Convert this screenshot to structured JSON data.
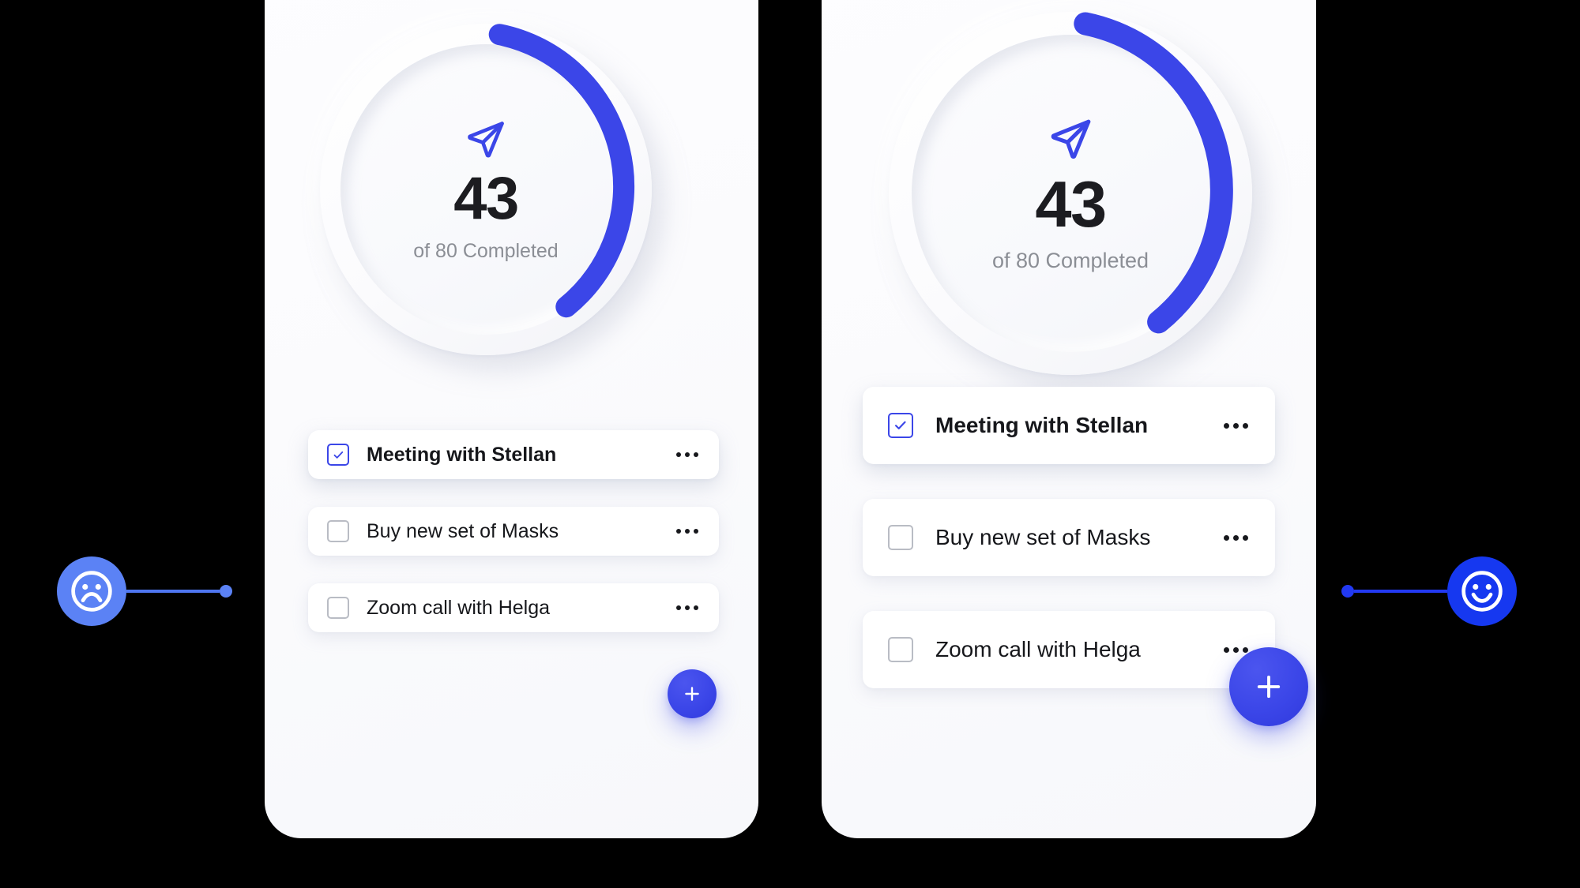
{
  "theme": {
    "background": "#000000",
    "card_background": "#fbfbfd",
    "accent_blue": "#3b46e8",
    "marker_blue_left": "#5b82f5",
    "marker_blue_right": "#1638f0",
    "value_text": "#1c1c20",
    "muted_text": "#8b8e95",
    "checkbox_idle": "#b9bcc4"
  },
  "cards": [
    {
      "id": "card-left",
      "variant": "small",
      "gauge": {
        "icon": "send-icon",
        "value": "43",
        "subtitle": "of 80 Completed",
        "completed": 43,
        "total": 80,
        "percent": 54,
        "track_color": "#f2f3f7",
        "arc_color": "#3b46e8"
      },
      "tasks": [
        {
          "label": "Meeting with Stellan",
          "checked": true,
          "menu_icon": "more-horizontal-icon"
        },
        {
          "label": "Buy new set of Masks",
          "checked": false,
          "menu_icon": "more-horizontal-icon"
        },
        {
          "label": "Zoom call with Helga",
          "checked": false,
          "menu_icon": "more-horizontal-icon"
        }
      ],
      "fab": {
        "icon": "plus-icon",
        "label": "+"
      }
    },
    {
      "id": "card-right",
      "variant": "large",
      "gauge": {
        "icon": "send-icon",
        "value": "43",
        "subtitle": "of 80 Completed",
        "completed": 43,
        "total": 80,
        "percent": 54,
        "track_color": "#f2f3f7",
        "arc_color": "#3b46e8"
      },
      "tasks": [
        {
          "label": "Meeting with Stellan",
          "checked": true,
          "menu_icon": "more-horizontal-icon"
        },
        {
          "label": "Buy new set of Masks",
          "checked": false,
          "menu_icon": "more-horizontal-icon"
        },
        {
          "label": "Zoom call with Helga",
          "checked": false,
          "menu_icon": "more-horizontal-icon"
        }
      ],
      "fab": {
        "icon": "plus-icon",
        "label": "+"
      }
    }
  ],
  "markers": [
    {
      "id": "marker-sad",
      "icon": "sad-face-icon",
      "side": "left",
      "color": "#5b82f5"
    },
    {
      "id": "marker-happy",
      "icon": "happy-face-icon",
      "side": "right",
      "color": "#1638f0"
    }
  ]
}
